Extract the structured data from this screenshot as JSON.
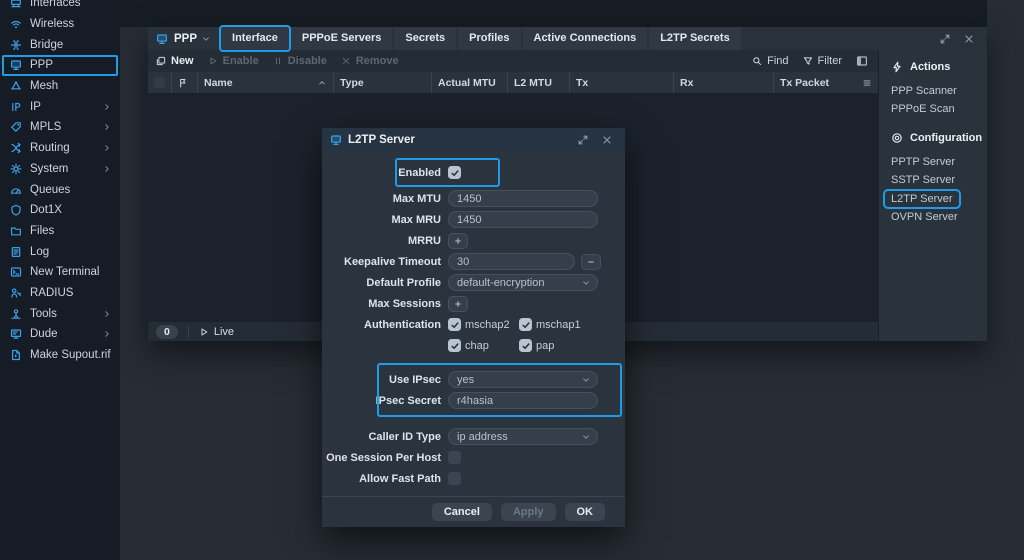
{
  "colors": {
    "accent": "#1f9ce6",
    "icon_blue": "#3aa1e8"
  },
  "sidebar": {
    "items": [
      {
        "label": "Interfaces",
        "icon": "interfaces-icon"
      },
      {
        "label": "Wireless",
        "icon": "wireless-icon"
      },
      {
        "label": "Bridge",
        "icon": "bridge-icon"
      },
      {
        "label": "PPP",
        "icon": "ppp-icon",
        "highlighted": true
      },
      {
        "label": "Mesh",
        "icon": "mesh-icon"
      },
      {
        "label": "IP",
        "icon": "ip-icon",
        "submenu": true
      },
      {
        "label": "MPLS",
        "icon": "mpls-icon",
        "submenu": true
      },
      {
        "label": "Routing",
        "icon": "routing-icon",
        "submenu": true
      },
      {
        "label": "System",
        "icon": "system-icon",
        "submenu": true
      },
      {
        "label": "Queues",
        "icon": "queues-icon"
      },
      {
        "label": "Dot1X",
        "icon": "dot1x-icon"
      },
      {
        "label": "Files",
        "icon": "files-icon"
      },
      {
        "label": "Log",
        "icon": "log-icon"
      },
      {
        "label": "New Terminal",
        "icon": "terminal-icon"
      },
      {
        "label": "RADIUS",
        "icon": "radius-icon"
      },
      {
        "label": "Tools",
        "icon": "tools-icon",
        "submenu": true
      },
      {
        "label": "Dude",
        "icon": "dude-icon",
        "submenu": true
      },
      {
        "label": "Make Supout.rif",
        "icon": "supout-icon"
      }
    ]
  },
  "window": {
    "title": "PPP",
    "tabs": [
      {
        "label": "Interface",
        "highlighted": true
      },
      {
        "label": "PPPoE Servers"
      },
      {
        "label": "Secrets"
      },
      {
        "label": "Profiles"
      },
      {
        "label": "Active Connections"
      },
      {
        "label": "L2TP Secrets"
      }
    ],
    "toolbar": {
      "buttons": [
        {
          "label": "New",
          "icon": "new-icon",
          "enabled": true
        },
        {
          "label": "Enable",
          "icon": "play-icon",
          "enabled": false
        },
        {
          "label": "Disable",
          "icon": "pause-icon",
          "enabled": false
        },
        {
          "label": "Remove",
          "icon": "remove-icon",
          "enabled": false
        }
      ],
      "find_label": "Find",
      "filter_label": "Filter"
    },
    "table": {
      "columns": [
        "Name",
        "Type",
        "Actual MTU",
        "L2 MTU",
        "Tx",
        "Rx",
        "Tx Packet"
      ]
    },
    "status": {
      "count": "0",
      "live_label": "Live"
    },
    "panel": {
      "sections": [
        {
          "title": "Actions",
          "icon": "actions-icon",
          "items": [
            {
              "label": "PPP Scanner"
            },
            {
              "label": "PPPoE Scan"
            }
          ]
        },
        {
          "title": "Configuration",
          "icon": "configuration-icon",
          "items": [
            {
              "label": "PPTP Server"
            },
            {
              "label": "SSTP Server"
            },
            {
              "label": "L2TP Server",
              "highlighted": true
            },
            {
              "label": "OVPN Server"
            }
          ]
        }
      ]
    }
  },
  "dialog": {
    "title": "L2TP Server",
    "rows": [
      {
        "label": "Enabled",
        "type": "checkbox",
        "checked": true,
        "highlighted": true
      },
      {
        "label": "Max MTU",
        "type": "input",
        "value": "1450"
      },
      {
        "label": "Max MRU",
        "type": "input",
        "value": "1450"
      },
      {
        "label": "MRRU",
        "type": "plus"
      },
      {
        "label": "Keepalive Timeout",
        "type": "input",
        "value": "30",
        "minus": true
      },
      {
        "label": "Default Profile",
        "type": "select",
        "value": "default-encryption"
      },
      {
        "label": "Max Sessions",
        "type": "plus"
      },
      {
        "label": "Authentication",
        "type": "checks",
        "options": [
          {
            "label": "mschap2",
            "checked": true
          },
          {
            "label": "mschap1",
            "checked": true
          },
          {
            "label": "chap",
            "checked": true
          },
          {
            "label": "pap",
            "checked": true
          }
        ]
      },
      {
        "label": "Use IPsec",
        "type": "select",
        "value": "yes",
        "group": "ipsec"
      },
      {
        "label": "IPsec Secret",
        "type": "input",
        "value": "r4hasia",
        "group": "ipsec"
      },
      {
        "label": "Caller ID Type",
        "type": "select",
        "value": "ip address"
      },
      {
        "label": "One Session Per Host",
        "type": "checkbox",
        "checked": false
      },
      {
        "label": "Allow Fast Path",
        "type": "checkbox",
        "checked": false
      }
    ],
    "buttons": [
      {
        "label": "Cancel",
        "enabled": true
      },
      {
        "label": "Apply",
        "enabled": false
      },
      {
        "label": "OK",
        "enabled": true
      }
    ]
  }
}
